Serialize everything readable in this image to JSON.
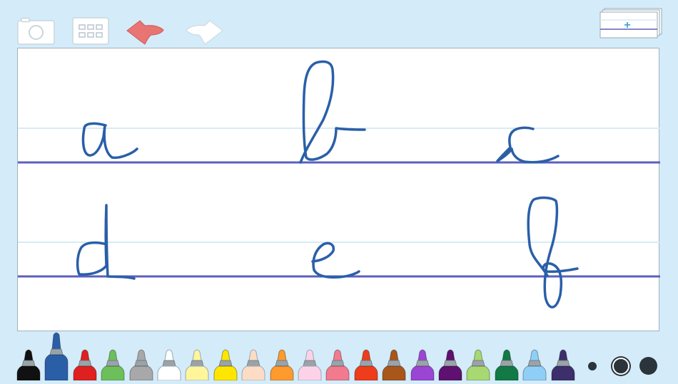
{
  "app": {
    "toolbar": [
      {
        "name": "camera-button",
        "icon": "camera-icon"
      },
      {
        "name": "grid-button",
        "icon": "grid-icon"
      },
      {
        "name": "undo-button",
        "icon": "undo-arrow-icon",
        "color": "#e87474"
      },
      {
        "name": "redo-button",
        "icon": "redo-arrow-icon",
        "color": "#ffffff"
      }
    ],
    "pages_button": {
      "icon": "add-page-icon",
      "symbol": "+"
    },
    "canvas": {
      "line_color_main": "#5b5fbf",
      "line_color_guide": "#d6ecf5",
      "ink_color": "#2a5fa8",
      "letters": [
        "a",
        "b",
        "c",
        "d",
        "e",
        "f"
      ]
    },
    "palette": {
      "markers": [
        {
          "color": "#111111",
          "selected": false
        },
        {
          "color": "#2a5fa8",
          "selected": true
        },
        {
          "color": "#e02020",
          "selected": false
        },
        {
          "color": "#6cbf5a",
          "selected": false
        },
        {
          "color": "#a8a8a8",
          "selected": false
        },
        {
          "color": "#ffffff",
          "selected": false
        },
        {
          "color": "#fff59a",
          "selected": false
        },
        {
          "color": "#ffe600",
          "selected": false
        },
        {
          "color": "#fcdcc4",
          "selected": false
        },
        {
          "color": "#ff9a2e",
          "selected": false
        },
        {
          "color": "#fdd2e8",
          "selected": false
        },
        {
          "color": "#f27a8e",
          "selected": false
        },
        {
          "color": "#ee3d1c",
          "selected": false
        },
        {
          "color": "#a8561a",
          "selected": false
        },
        {
          "color": "#9b45d4",
          "selected": false
        },
        {
          "color": "#5e1170",
          "selected": false
        },
        {
          "color": "#a7d872",
          "selected": false
        },
        {
          "color": "#117a45",
          "selected": false
        },
        {
          "color": "#8fcff7",
          "selected": false
        },
        {
          "color": "#3d2f6b",
          "selected": false
        }
      ],
      "brush_sizes": [
        {
          "name": "brush-size-small",
          "selected": false
        },
        {
          "name": "brush-size-medium",
          "selected": true
        },
        {
          "name": "brush-size-large",
          "selected": false
        }
      ]
    }
  }
}
